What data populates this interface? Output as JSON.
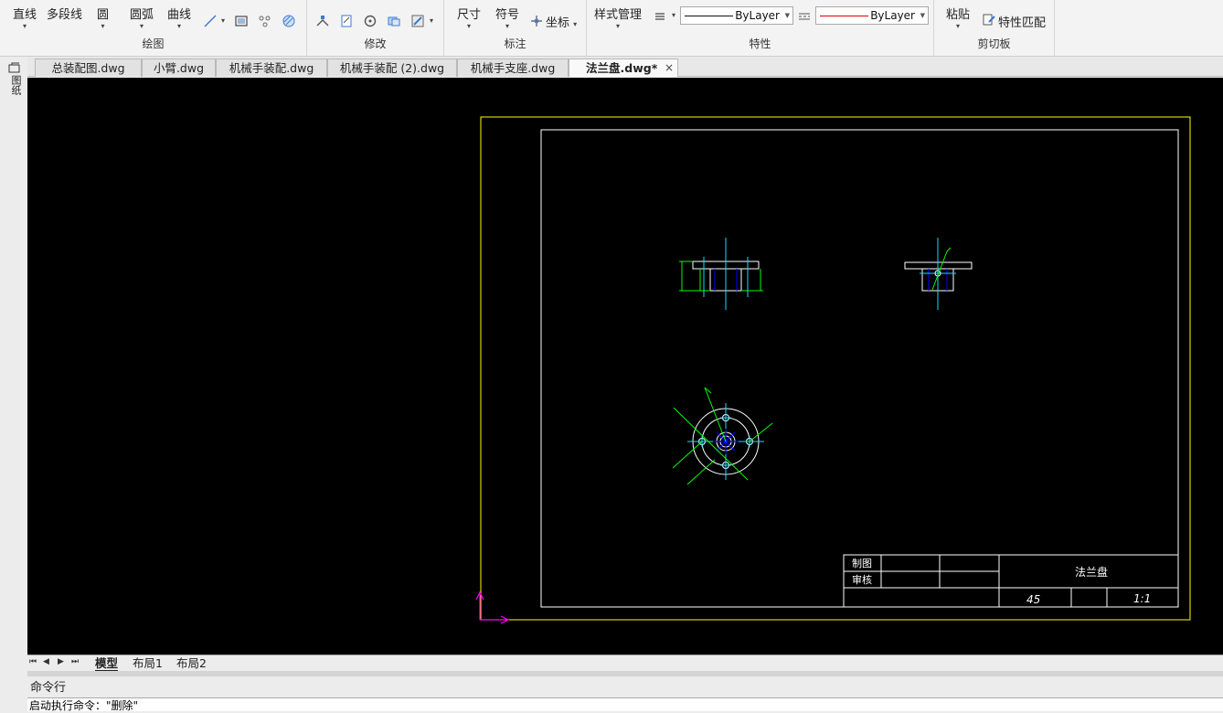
{
  "ribbon": {
    "draw": {
      "label": "绘图",
      "buttons": [
        "直线",
        "多段线",
        "圆",
        "圆弧",
        "曲线"
      ]
    },
    "modify": {
      "label": "修改"
    },
    "annotate": {
      "label": "标注",
      "dimension": "尺寸",
      "symbol": "符号",
      "coordinate": "坐标"
    },
    "properties": {
      "label": "特性",
      "style_manager": "样式管理",
      "linetype_value": "ByLayer",
      "color_value": "ByLayer"
    },
    "clipboard": {
      "label": "剪切板",
      "paste": "粘贴",
      "match_properties": "特性匹配"
    }
  },
  "left_strip": {
    "label": "图纸"
  },
  "tabs": [
    {
      "label": "总装配图.dwg"
    },
    {
      "label": "小臂.dwg"
    },
    {
      "label": "机械手装配.dwg"
    },
    {
      "label": "机械手装配 (2).dwg"
    },
    {
      "label": "机械手支座.dwg"
    },
    {
      "label": "法兰盘.dwg*",
      "active": true
    }
  ],
  "close_glyph": "×",
  "drawing": {
    "title_block": {
      "drawn": "制图",
      "checked": "审核",
      "part_name": "法兰盘",
      "material": "45",
      "scale": "1:1"
    }
  },
  "layout_tabs": [
    "模型",
    "布局1",
    "布局2"
  ],
  "nav_glyphs": [
    "⏮",
    "◀",
    "▶",
    "⏭"
  ],
  "command": {
    "title": "命令行",
    "last_line": "启动执行命令：\"删除\""
  },
  "colors": {
    "canvas": "#000000",
    "sheet_border": "#ffff00",
    "frame": "#ffffff",
    "center_line": "#00e5ff",
    "dimension": "#00ff00",
    "hidden": "#0000ff",
    "ucs_icon": "#ff00ff",
    "color_swatch": "#e00000"
  }
}
